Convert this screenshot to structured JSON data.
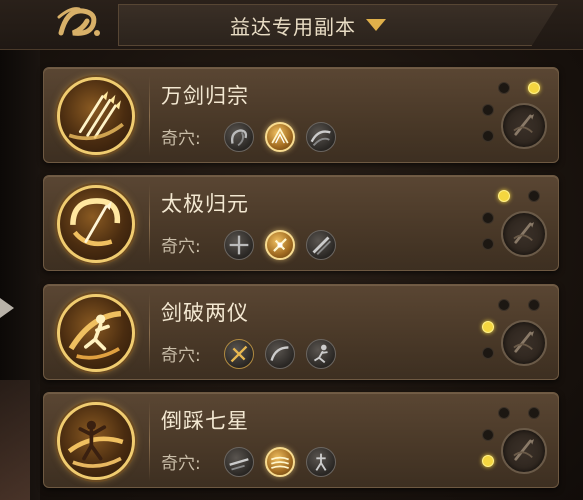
{
  "header": {
    "title": "益达专用副本",
    "logo_icon": "calligraphy-seal-icon",
    "dropdown_icon": "triangle-down-icon",
    "accent_color": "#e0b04a"
  },
  "qixue_label": "奇穴:",
  "cards": [
    {
      "name": "万剑归宗",
      "emblem_icon": "sword-rain-icon",
      "qixue": [
        {
          "icon": "dark-swirl-icon",
          "active": false
        },
        {
          "icon": "golden-blades-icon",
          "active": true
        },
        {
          "icon": "dark-wave-icon",
          "active": false
        }
      ],
      "dots": {
        "top_left": false,
        "top_right": true,
        "left": false,
        "bottom_left": false
      }
    },
    {
      "name": "太极归元",
      "emblem_icon": "taiji-sword-icon",
      "qixue": [
        {
          "icon": "dark-pinwheel-icon",
          "active": false
        },
        {
          "icon": "golden-burst-icon",
          "active": true
        },
        {
          "icon": "dark-slash-icon",
          "active": false
        }
      ],
      "dots": {
        "top_left": true,
        "top_right": false,
        "left": false,
        "bottom_left": false
      }
    },
    {
      "name": "剑破两仪",
      "emblem_icon": "leaping-swordsman-icon",
      "qixue": [
        {
          "icon": "golden-cross-icon",
          "active": false
        },
        {
          "icon": "dark-arc-icon",
          "active": false
        },
        {
          "icon": "dark-runner-icon",
          "active": false
        }
      ],
      "dots": {
        "top_left": false,
        "top_right": false,
        "left": true,
        "bottom_left": false
      }
    },
    {
      "name": "倒踩七星",
      "emblem_icon": "dancing-swordsman-icon",
      "qixue": [
        {
          "icon": "dark-dash-icon",
          "active": false
        },
        {
          "icon": "golden-streak-icon",
          "active": true
        },
        {
          "icon": "dark-figure-icon",
          "active": false
        }
      ],
      "dots": {
        "top_left": false,
        "top_right": false,
        "left": false,
        "bottom_left": true
      }
    }
  ],
  "school_badge_icon": "chunyang-sword-badge-icon"
}
